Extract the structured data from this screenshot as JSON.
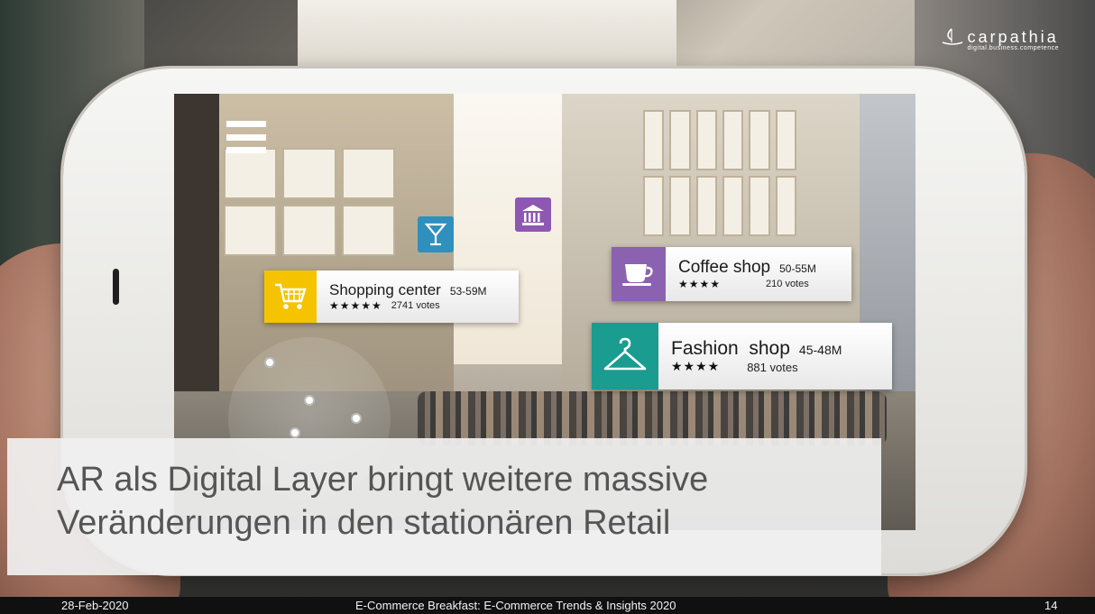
{
  "slide": {
    "title_line1": "AR als Digital Layer bringt weitere massive",
    "title_line2": "Veränderungen in den stationären Retail"
  },
  "logo": {
    "name": "carpathia",
    "tagline": "digital.business.competence"
  },
  "ar_cards": {
    "shopping": {
      "name": "Shopping center",
      "distance": "53-59M",
      "stars": "★★★★★",
      "rating": 5,
      "votes": "2741 votes",
      "icon": "shopping-cart-icon",
      "color": "#f5c300"
    },
    "coffee": {
      "name": "Coffee shop",
      "distance": "50-55M",
      "stars": "★★★★",
      "rating": 4,
      "votes": "210 votes",
      "icon": "coffee-cup-icon",
      "color": "#8b62b0"
    },
    "fashion": {
      "name": "Fashion  shop",
      "distance": "45-48M",
      "stars": "★★★★",
      "rating": 4,
      "votes": "881 votes",
      "icon": "hanger-icon",
      "color": "#1a9c90"
    }
  },
  "poi_icons": {
    "bar": {
      "icon": "cocktail-glass-icon",
      "color": "#2f8fbd"
    },
    "museum": {
      "icon": "museum-icon",
      "color": "#8e57b3"
    }
  },
  "footer": {
    "date": "28-Feb-2020",
    "event": "E-Commerce Breakfast: E-Commerce Trends & Insights 2020",
    "page": "14"
  }
}
